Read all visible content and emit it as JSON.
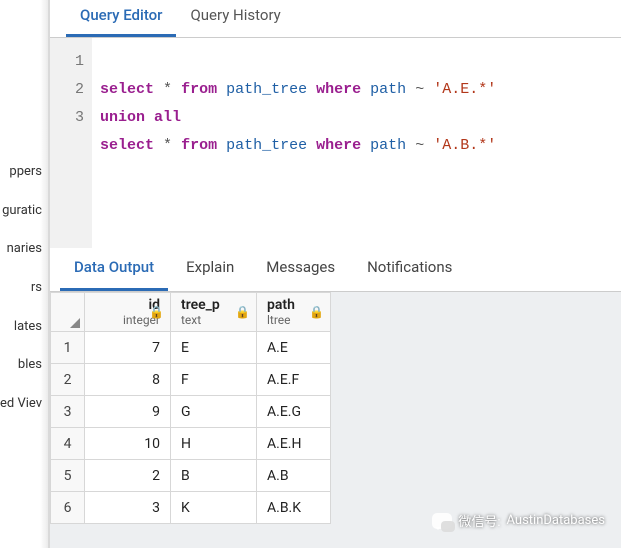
{
  "sidebar": {
    "items": [
      {
        "label": "ppers"
      },
      {
        "label": "guratic"
      },
      {
        "label": "naries"
      },
      {
        "label": "rs"
      },
      {
        "label": "lates"
      },
      {
        "label": "bles"
      },
      {
        "label": "ed Viev"
      }
    ]
  },
  "topTabs": [
    {
      "label": "Query Editor",
      "active": true
    },
    {
      "label": "Query History",
      "active": false
    }
  ],
  "editor": {
    "lines": [
      1,
      2,
      3
    ],
    "sql": {
      "l1": {
        "kw1": "select",
        "star": "*",
        "kw2": "from",
        "tbl": "path_tree",
        "kw3": "where",
        "col": "path",
        "op": "~",
        "str": "'A.E.*'"
      },
      "l2": {
        "kw1": "union",
        "kw2": "all"
      },
      "l3": {
        "kw1": "select",
        "star": "*",
        "kw2": "from",
        "tbl": "path_tree",
        "kw3": "where",
        "col": "path",
        "op": "~",
        "str": "'A.B.*'"
      }
    }
  },
  "resultTabs": [
    {
      "label": "Data Output",
      "active": true
    },
    {
      "label": "Explain",
      "active": false
    },
    {
      "label": "Messages",
      "active": false
    },
    {
      "label": "Notifications",
      "active": false
    }
  ],
  "columns": [
    {
      "name": "id",
      "type": "integer"
    },
    {
      "name": "tree_p",
      "type": "text"
    },
    {
      "name": "path",
      "type": "ltree"
    }
  ],
  "rows": [
    {
      "n": 1,
      "id": 7,
      "tree_p": "E",
      "path": "A.E"
    },
    {
      "n": 2,
      "id": 8,
      "tree_p": "F",
      "path": "A.E.F"
    },
    {
      "n": 3,
      "id": 9,
      "tree_p": "G",
      "path": "A.E.G"
    },
    {
      "n": 4,
      "id": 10,
      "tree_p": "H",
      "path": "A.E.H"
    },
    {
      "n": 5,
      "id": 2,
      "tree_p": "B",
      "path": "A.B"
    },
    {
      "n": 6,
      "id": 3,
      "tree_p": "K",
      "path": "A.B.K"
    }
  ],
  "watermark": {
    "prefix": "微信号:",
    "value": "AustinDatabases"
  },
  "icons": {
    "lock": "🔒"
  }
}
